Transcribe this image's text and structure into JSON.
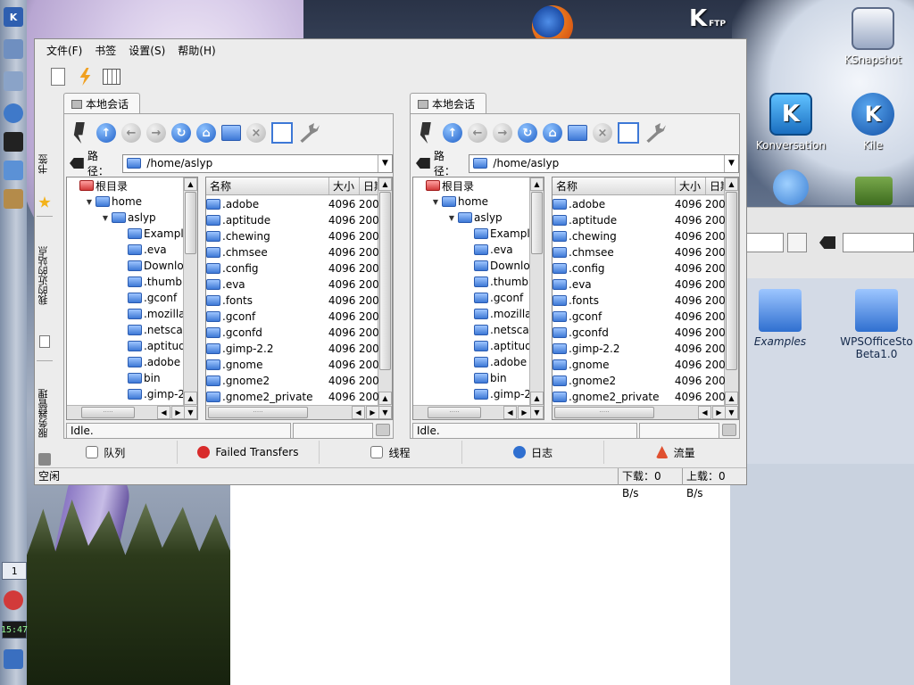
{
  "menubar": {
    "file": "文件(F)",
    "bookmarks": "书签",
    "settings": "设置(S)",
    "help": "帮助(H)"
  },
  "side_tabs": {
    "bookmarks": "书签",
    "recent": "我的近的站点",
    "server_manager": "服务器管理"
  },
  "left_pane": {
    "tab": "本地会话",
    "path_label": "路径：",
    "path": "/home/aslyp",
    "tree": [
      {
        "label": "根目录",
        "level": 0,
        "kind": "root",
        "expander": ""
      },
      {
        "label": "home",
        "level": 1,
        "kind": "folder",
        "expander": "▼"
      },
      {
        "label": "aslyp",
        "level": 2,
        "kind": "folder",
        "expander": "▼"
      },
      {
        "label": "Example",
        "level": 3,
        "kind": "folder",
        "expander": ""
      },
      {
        "label": ".eva",
        "level": 3,
        "kind": "folder",
        "expander": ""
      },
      {
        "label": "Downloa",
        "level": 3,
        "kind": "folder",
        "expander": ""
      },
      {
        "label": ".thumbn",
        "level": 3,
        "kind": "folder",
        "expander": ""
      },
      {
        "label": ".gconf",
        "level": 3,
        "kind": "folder",
        "expander": ""
      },
      {
        "label": ".mozilla",
        "level": 3,
        "kind": "folder",
        "expander": ""
      },
      {
        "label": ".netscap",
        "level": 3,
        "kind": "folder",
        "expander": ""
      },
      {
        "label": ".aptitude",
        "level": 3,
        "kind": "folder",
        "expander": ""
      },
      {
        "label": ".adobe",
        "level": 3,
        "kind": "folder",
        "expander": ""
      },
      {
        "label": "bin",
        "level": 3,
        "kind": "folder",
        "expander": ""
      },
      {
        "label": ".gimp-2.",
        "level": 3,
        "kind": "folder",
        "expander": ""
      }
    ],
    "columns": {
      "name": "名称",
      "size": "大小",
      "date": "日期"
    },
    "files": [
      {
        "name": ".adobe",
        "size": "4096",
        "date": "200"
      },
      {
        "name": ".aptitude",
        "size": "4096",
        "date": "200"
      },
      {
        "name": ".chewing",
        "size": "4096",
        "date": "200"
      },
      {
        "name": ".chmsee",
        "size": "4096",
        "date": "200"
      },
      {
        "name": ".config",
        "size": "4096",
        "date": "200"
      },
      {
        "name": ".eva",
        "size": "4096",
        "date": "200"
      },
      {
        "name": ".fonts",
        "size": "4096",
        "date": "200"
      },
      {
        "name": ".gconf",
        "size": "4096",
        "date": "200"
      },
      {
        "name": ".gconfd",
        "size": "4096",
        "date": "200"
      },
      {
        "name": ".gimp-2.2",
        "size": "4096",
        "date": "200"
      },
      {
        "name": ".gnome",
        "size": "4096",
        "date": "200"
      },
      {
        "name": ".gnome2",
        "size": "4096",
        "date": "200"
      },
      {
        "name": ".gnome2_private",
        "size": "4096",
        "date": "200"
      }
    ],
    "status": "Idle."
  },
  "right_pane": {
    "tab": "本地会话",
    "path_label": "路径：",
    "path": "/home/aslyp",
    "tree": [
      {
        "label": "根目录",
        "level": 0,
        "kind": "root",
        "expander": ""
      },
      {
        "label": "home",
        "level": 1,
        "kind": "folder",
        "expander": "▼"
      },
      {
        "label": "aslyp",
        "level": 2,
        "kind": "folder",
        "expander": "▼"
      },
      {
        "label": "Example",
        "level": 3,
        "kind": "folder",
        "expander": ""
      },
      {
        "label": ".eva",
        "level": 3,
        "kind": "folder",
        "expander": ""
      },
      {
        "label": "Downloa",
        "level": 3,
        "kind": "folder",
        "expander": ""
      },
      {
        "label": ".thumbn",
        "level": 3,
        "kind": "folder",
        "expander": ""
      },
      {
        "label": ".gconf",
        "level": 3,
        "kind": "folder",
        "expander": ""
      },
      {
        "label": ".mozilla",
        "level": 3,
        "kind": "folder",
        "expander": ""
      },
      {
        "label": ".netscap",
        "level": 3,
        "kind": "folder",
        "expander": ""
      },
      {
        "label": ".aptitude",
        "level": 3,
        "kind": "folder",
        "expander": ""
      },
      {
        "label": ".adobe",
        "level": 3,
        "kind": "folder",
        "expander": ""
      },
      {
        "label": "bin",
        "level": 3,
        "kind": "folder",
        "expander": ""
      },
      {
        "label": ".gimp-2.",
        "level": 3,
        "kind": "folder",
        "expander": ""
      }
    ],
    "columns": {
      "name": "名称",
      "size": "大小",
      "date": "日期"
    },
    "files": [
      {
        "name": ".adobe",
        "size": "4096",
        "date": "200"
      },
      {
        "name": ".aptitude",
        "size": "4096",
        "date": "200"
      },
      {
        "name": ".chewing",
        "size": "4096",
        "date": "200"
      },
      {
        "name": ".chmsee",
        "size": "4096",
        "date": "200"
      },
      {
        "name": ".config",
        "size": "4096",
        "date": "200"
      },
      {
        "name": ".eva",
        "size": "4096",
        "date": "200"
      },
      {
        "name": ".fonts",
        "size": "4096",
        "date": "200"
      },
      {
        "name": ".gconf",
        "size": "4096",
        "date": "200"
      },
      {
        "name": ".gconfd",
        "size": "4096",
        "date": "200"
      },
      {
        "name": ".gimp-2.2",
        "size": "4096",
        "date": "200"
      },
      {
        "name": ".gnome",
        "size": "4096",
        "date": "200"
      },
      {
        "name": ".gnome2",
        "size": "4096",
        "date": "200"
      },
      {
        "name": ".gnome2_private",
        "size": "4096",
        "date": "200"
      }
    ],
    "status": "Idle."
  },
  "bottom_tabs": {
    "queue": "队列",
    "failed": "Failed Transfers",
    "threads": "线程",
    "log": "日志",
    "traffic": "流量"
  },
  "statusbar": {
    "state": "空闲",
    "download": "下载：0 B/s",
    "upload": "上载：0 B/s"
  },
  "desktop": {
    "ksnapshot": "KSnapshot",
    "konversation": "Konversation",
    "kile": "Kile",
    "examples": "Examples",
    "wps": "WPSOfficeSto Beta1.0",
    "kftp_letter": "K",
    "kftp_sub": "FTP"
  },
  "panel": {
    "desktop_num": "1",
    "clock": "15:47"
  },
  "colors": {
    "accent_blue": "#1f5fc7",
    "window_bg": "#ececec"
  }
}
